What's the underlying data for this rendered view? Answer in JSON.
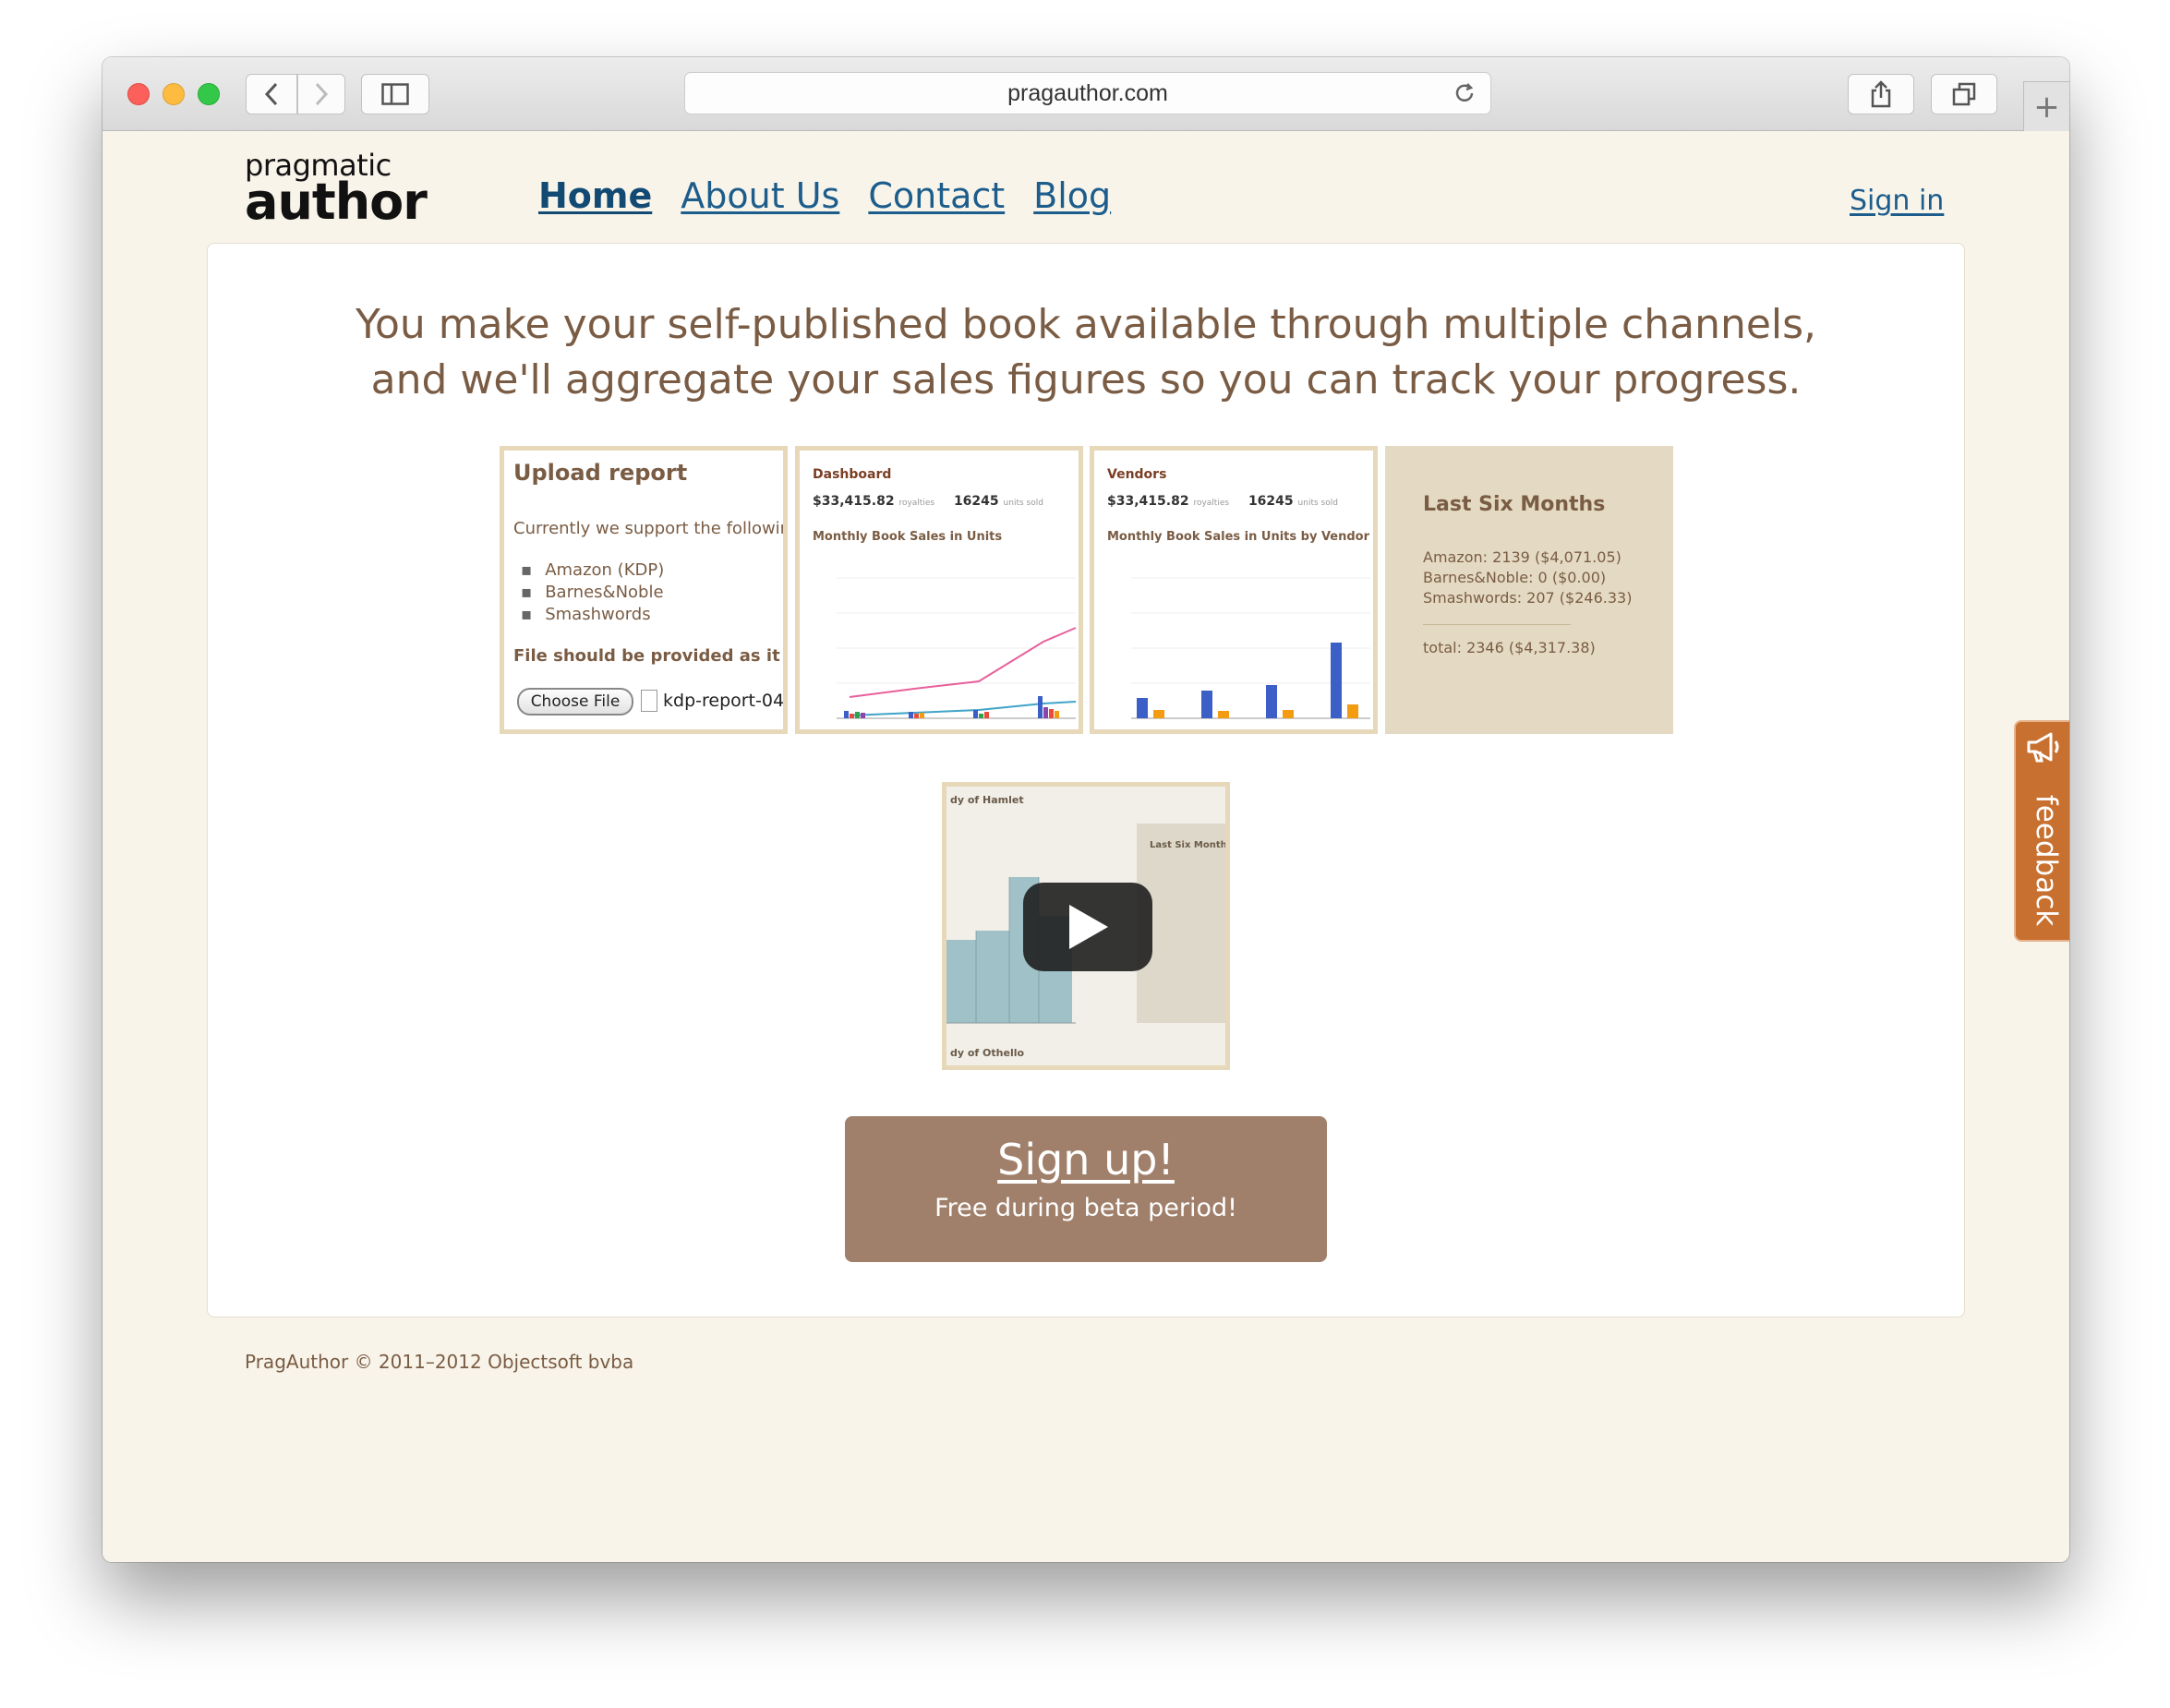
{
  "browser": {
    "url": "pragauthor.com"
  },
  "logo": {
    "line1": "pragmatic",
    "line2": "author"
  },
  "nav": {
    "items": [
      "Home",
      "About Us",
      "Contact",
      "Blog"
    ],
    "active": "Home",
    "signin": "Sign in"
  },
  "hero": {
    "line1": "You make your self-published book available through multiple channels,",
    "line2": "and we'll aggregate your sales figures so you can track your progress."
  },
  "thumbnails": {
    "upload": {
      "title": "Upload report",
      "intro": "Currently we support the following",
      "vendors": [
        "Amazon (KDP)",
        "Barnes&Noble",
        "Smashwords"
      ],
      "note": "File should be provided as it was rec",
      "choose_label": "Choose File",
      "file_name": "kdp-report-04"
    },
    "dashboard": {
      "title": "Dashboard",
      "royalties": "$33,415.82",
      "royalties_label": "royalties",
      "units": "16245",
      "units_label": "units sold",
      "subtitle": "Monthly Book Sales in Units"
    },
    "vendors": {
      "title": "Vendors",
      "royalties": "$33,415.82",
      "royalties_label": "royalties",
      "units": "16245",
      "units_label": "units sold",
      "subtitle": "Monthly Book Sales in Units by Vendor"
    },
    "last_six": {
      "title": "Last Six Months",
      "lines": [
        "Amazon: 2139 ($4,071.05)",
        "Barnes&Noble: 0 ($0.00)",
        "Smashwords: 207 ($246.33)"
      ],
      "total": "total: 2346  ($4,317.38)"
    }
  },
  "video": {
    "caption_top": "dy of Hamlet",
    "caption_bottom": "dy of Othello",
    "side_title": "Last Six Month"
  },
  "cta": {
    "main": "Sign up!",
    "sub": "Free during beta period!"
  },
  "footer": {
    "text": "PragAuthor © 2011–2012 Objectsoft bvba"
  },
  "feedback": {
    "label": "feedback"
  },
  "colors": {
    "page_bg": "#f8f4ea",
    "link": "#1d5d8c",
    "text_brown": "#7a5c44",
    "cta_bg": "#a0806b",
    "feedback_bg": "#c8702f",
    "thumb_border": "#e6d8b8"
  },
  "icons": [
    "back-icon",
    "forward-icon",
    "sidebar-icon",
    "reload-icon",
    "share-icon",
    "tabs-icon",
    "plus-icon",
    "play-icon",
    "megaphone-icon",
    "file-icon"
  ]
}
